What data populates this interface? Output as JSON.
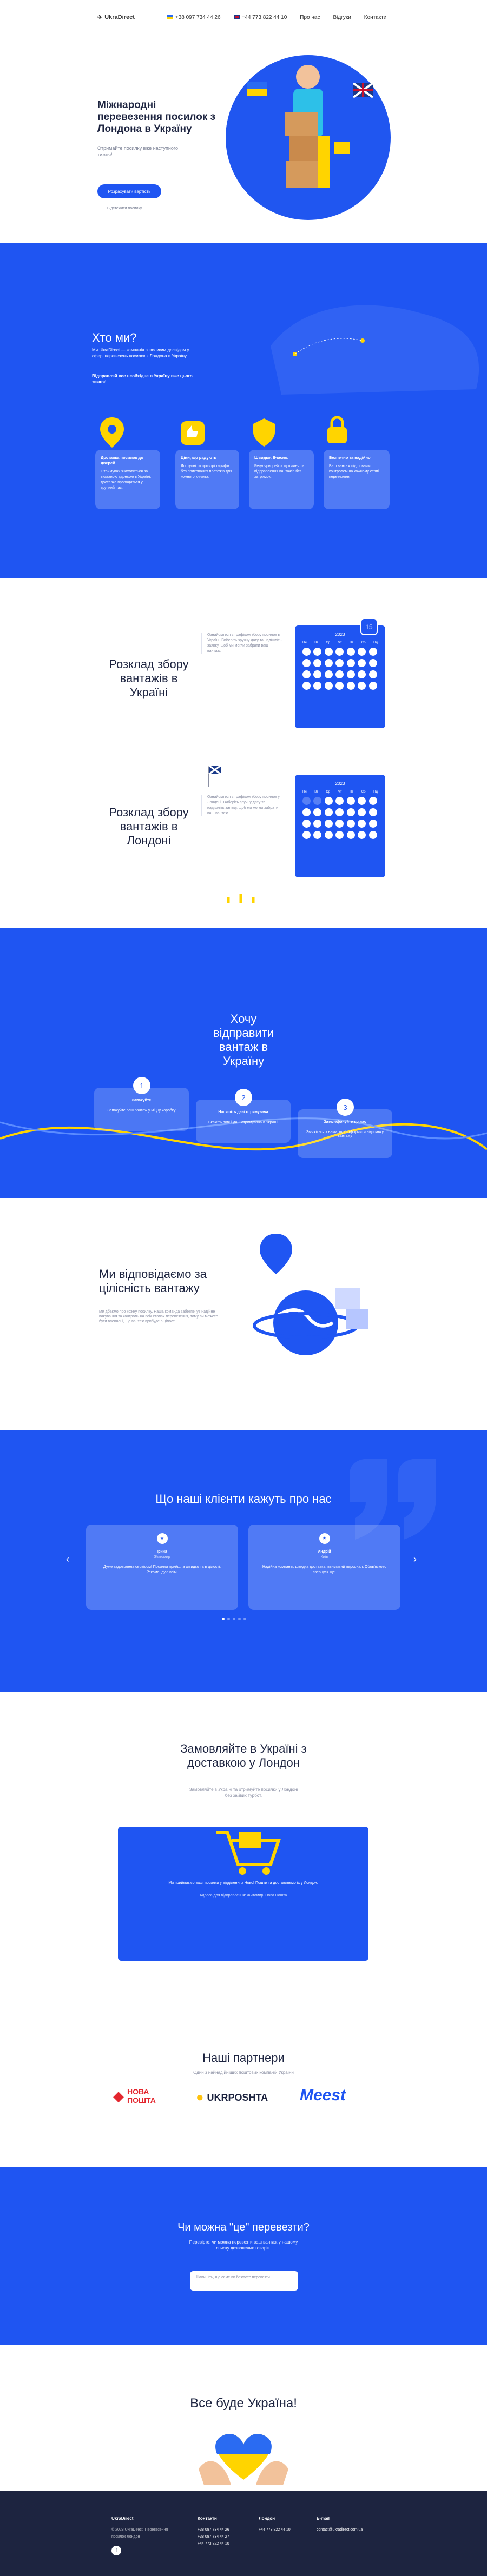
{
  "header": {
    "logo": "UkraDirect",
    "phone_ua": "+38 097 734 44 26",
    "phone_uk": "+44 773 822 44 10",
    "nav": [
      "Про нас",
      "Відгуки",
      "Контакти"
    ]
  },
  "hero": {
    "title": "Міжнародні перевезення посилок з Лондона в Україну",
    "subtitle": "Отримайте посилку вже наступного тижня!",
    "cta": "Розрахувати вартість",
    "track": "Відстежити посилку"
  },
  "who": {
    "title": "Хто ми?",
    "text1": "Ми UkraDirect — компанія із великим досвідом у сфері перевезень посилок з Лондона в Україну.",
    "text2": "Відправляй все необхідне в Україну вже цього тижня!",
    "cards": [
      {
        "title": "Доставка посилок до дверей",
        "text": "Отримувач знаходиться за вказаною адресою в Україні, доставка проводиться у зручний час."
      },
      {
        "title": "Ціни, що радують",
        "text": "Доступні та прозорі тарифи без прихованих платежів для кожного клієнта."
      },
      {
        "title": "Швидко. Вчасно.",
        "text": "Регулярні рейси щотижня та відправлення вантажів без затримок."
      },
      {
        "title": "Безпечно та надійно",
        "text": "Ваш вантаж під повним контролем на кожному етапі перевезення."
      }
    ]
  },
  "sched_ua": {
    "title": "Розклад збору вантажів в Україні",
    "note": "Ознайомтеся з графіком збору посилок в Україні. Виберіть зручну дату та надішліть заявку, щоб ми могли забрати ваш вантаж.",
    "year": "2023"
  },
  "sched_uk": {
    "title": "Розклад збору вантажів в Лондоні",
    "note": "Ознайомтеся з графіком збору посилок у Лондоні. Виберіть зручну дату та надішліть заявку, щоб ми могли забрати ваш вантаж.",
    "year": "2023"
  },
  "weekdays": [
    "Пн",
    "Вт",
    "Ср",
    "Чт",
    "Пт",
    "Сб",
    "Нд"
  ],
  "send": {
    "title": "Хочу відправити вантаж в Україну",
    "steps": [
      {
        "n": "1",
        "title": "Запакуйте",
        "text": "Запакуйте ваш вантаж у міцну коробку"
      },
      {
        "n": "2",
        "title": "Напишіть дані отримувача",
        "text": "Вкажіть повні дані отримувача в Україні"
      },
      {
        "n": "3",
        "title": "Зателефонуйте до нас",
        "text": "Зв'яжіться з нами, щоб оформити відправку вантажу"
      }
    ]
  },
  "integ": {
    "title": "Ми відповідаємо за цілісність вантажу",
    "text": "Ми дбаємо про кожну посилку. Наша команда забезпечує надійне пакування та контроль на всіх етапах перевезення, тому ви можете бути впевнені, що вантаж прибуде в цілості."
  },
  "reviews": {
    "title": "Що наші клієнти кажуть про нас",
    "items": [
      {
        "name": "Ірина",
        "city": "Житомир",
        "text": "Дуже задоволена сервісом! Посилка прийшла швидко та в цілості. Рекомендую всім."
      },
      {
        "name": "Андрій",
        "city": "Київ",
        "text": "Надійна компанія, швидка доставка, ввічливий персонал. Обов'язково звернуся ще."
      }
    ]
  },
  "order": {
    "title": "Замовляйте в Україні з доставкою у Лондон",
    "desc": "Замовляйте в Україні та отримуйте посилки у Лондоні без зайвих турбот.",
    "box_text": "Ми приймаємо ваші посилки у відділеннях Нової Пошти та доставляємо їх у Лондон.",
    "box_addr": "Адреса для відправлення: Житомир, Нова Пошта"
  },
  "partners": {
    "title": "Наші партнери",
    "sub": "Один з найнадійніших поштових компаній України",
    "logos": [
      "НОВА ПОШТА",
      "UKRPOSHTA",
      "Meest"
    ]
  },
  "prohib": {
    "title": "Чи можна \"це\" перевезти?",
    "text": "Перевірте, чи можна перевезти ваш вантаж у нашому списку дозволених товарів.",
    "placeholder": "Напишіть, що саме ви бажаєте перевезти"
  },
  "glory": {
    "title": "Все буде Україна!"
  },
  "footer": {
    "logo": "UkraDirect",
    "copy": "© 2023 UkraDirect. Перевезення посилок Лондон",
    "col1": "Контакти",
    "col2": "Лондон",
    "col3": "E-mail",
    "ua": [
      "+38 097 734 44 26",
      "+38 097 734 44 27",
      "+44 773 822 44 10"
    ],
    "uk": [
      "+44 773 822 44 10"
    ],
    "email": "contact@ukradirect.com.ua"
  },
  "colors": {
    "primary": "#1f55f2",
    "dark": "#1d2440",
    "accent": "#ffd400"
  }
}
